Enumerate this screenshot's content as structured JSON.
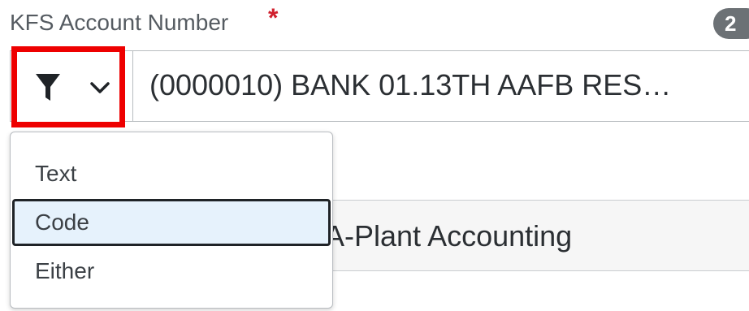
{
  "field": {
    "label": "KFS Account Number",
    "required_marker": "*",
    "badge": "2",
    "value": "(0000010) BANK 01.13TH AAFB RES…"
  },
  "filter": {
    "icon": "filter-icon",
    "chevron": "chevron-down-icon",
    "options": [
      "Text",
      "Code",
      "Either"
    ],
    "highlighted": "Code"
  },
  "second_field": {
    "value": "A-Plant Accounting"
  },
  "colors": {
    "highlight_box": "#ee0000",
    "required": "#d0202e",
    "selected_bg": "#e6f2fc"
  }
}
